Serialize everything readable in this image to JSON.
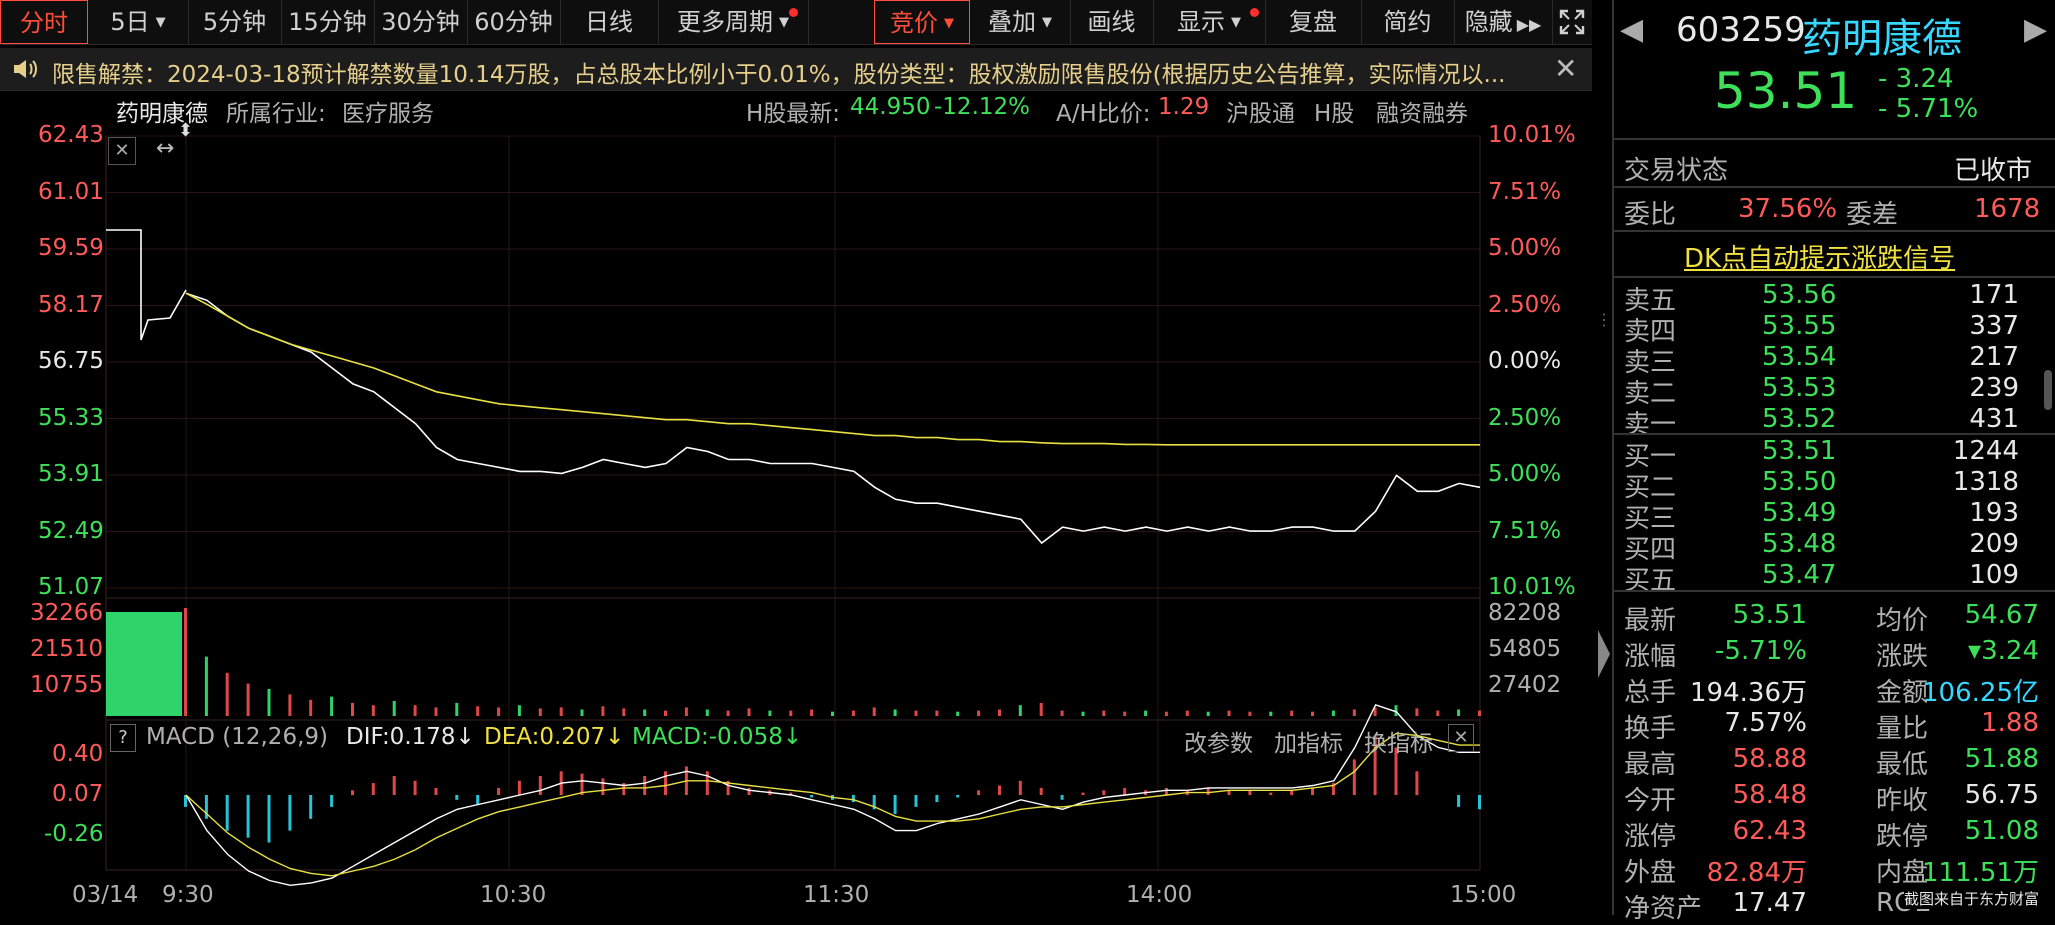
{
  "toolbar": {
    "tabs": [
      {
        "label": "分时",
        "active": true
      },
      {
        "label": "5日"
      },
      {
        "label": "5分钟"
      },
      {
        "label": "15分钟"
      },
      {
        "label": "30分钟"
      },
      {
        "label": "60分钟"
      },
      {
        "label": "日线"
      },
      {
        "label": "更多周期"
      }
    ],
    "right_buttons": [
      "竞价",
      "叠加",
      "画线",
      "显示",
      "复盘",
      "简约",
      "隐藏"
    ]
  },
  "notice": {
    "text": "限售解禁：2024-03-18预计解禁数量10.14万股，占总股本比例小于0.01%，股份类型：股权激励限售股份(根据历史公告推算，实际情况以..."
  },
  "chart_header": {
    "name": "药明康德",
    "industry_label": "所属行业:",
    "industry": "医疗服务",
    "h_label": "H股最新:",
    "h_price": "44.950",
    "h_change": "-12.12%",
    "ah_label": "A/H比价:",
    "ah_value": "1.29",
    "tags": [
      "沪股通",
      "H股",
      "融资融券"
    ]
  },
  "chart_data": {
    "type": "line",
    "x_ticks": [
      "03/14",
      "9:30",
      "10:30",
      "11:30",
      "14:00",
      "15:00"
    ],
    "price_axis": [
      "62.43",
      "61.01",
      "59.59",
      "58.17",
      "56.75",
      "55.33",
      "53.91",
      "52.49",
      "51.07"
    ],
    "pct_axis": [
      "10.01%",
      "7.51%",
      "5.00%",
      "2.50%",
      "0.00%",
      "2.50%",
      "5.00%",
      "7.51%",
      "10.01%"
    ],
    "ylim": [
      51.07,
      62.43
    ],
    "prev_close": 56.75,
    "series": [
      {
        "name": "price",
        "color": "#ffffff",
        "values": [
          58.48,
          58.3,
          57.9,
          57.6,
          57.4,
          57.2,
          57.0,
          56.6,
          56.2,
          56.0,
          55.6,
          55.2,
          54.6,
          54.3,
          54.2,
          54.1,
          54.0,
          54.0,
          53.95,
          54.1,
          54.3,
          54.2,
          54.1,
          54.2,
          54.6,
          54.5,
          54.3,
          54.3,
          54.2,
          54.2,
          54.2,
          54.1,
          54.0,
          53.6,
          53.3,
          53.2,
          53.2,
          53.1,
          53.0,
          52.9,
          52.8,
          52.2,
          52.6,
          52.5,
          52.6,
          52.5,
          52.6,
          52.5,
          52.6,
          52.5,
          52.6,
          52.5,
          52.5,
          52.6,
          52.6,
          52.5,
          52.5,
          53.0,
          53.9,
          53.5,
          53.5,
          53.7,
          53.6
        ]
      },
      {
        "name": "avg",
        "color": "#e8e040",
        "values": [
          58.48,
          58.2,
          57.9,
          57.6,
          57.4,
          57.2,
          57.05,
          56.9,
          56.75,
          56.6,
          56.4,
          56.2,
          56.0,
          55.9,
          55.8,
          55.7,
          55.65,
          55.6,
          55.55,
          55.5,
          55.45,
          55.4,
          55.35,
          55.3,
          55.3,
          55.25,
          55.2,
          55.2,
          55.15,
          55.1,
          55.05,
          55.0,
          54.95,
          54.9,
          54.9,
          54.85,
          54.85,
          54.8,
          54.8,
          54.75,
          54.75,
          54.72,
          54.7,
          54.7,
          54.7,
          54.68,
          54.68,
          54.67,
          54.67,
          54.67,
          54.67,
          54.67,
          54.67,
          54.67,
          54.67,
          54.67,
          54.67,
          54.67,
          54.67,
          54.67,
          54.67,
          54.67,
          54.67
        ]
      }
    ]
  },
  "volume": {
    "left_axis": [
      "32266",
      "21510",
      "10755"
    ],
    "right_axis": [
      "82208",
      "54805",
      "27402"
    ],
    "values": [
      1.0,
      0.55,
      0.4,
      0.3,
      0.25,
      0.2,
      0.15,
      0.18,
      0.12,
      0.1,
      0.14,
      0.1,
      0.08,
      0.12,
      0.09,
      0.08,
      0.1,
      0.07,
      0.08,
      0.06,
      0.09,
      0.07,
      0.06,
      0.05,
      0.08,
      0.06,
      0.05,
      0.07,
      0.05,
      0.05,
      0.06,
      0.04,
      0.05,
      0.08,
      0.06,
      0.05,
      0.05,
      0.04,
      0.05,
      0.06,
      0.1,
      0.12,
      0.05,
      0.04,
      0.05,
      0.04,
      0.05,
      0.04,
      0.05,
      0.04,
      0.05,
      0.04,
      0.04,
      0.05,
      0.04,
      0.05,
      0.06,
      0.08,
      0.1,
      0.07,
      0.05,
      0.06,
      0.05
    ]
  },
  "macd": {
    "help": "?",
    "label": "MACD (12,26,9)",
    "dif": "DIF:0.178↓",
    "dea": "DEA:0.207↓",
    "macd": "MACD:-0.058↓",
    "buttons": [
      "改参数",
      "加指标",
      "换指标"
    ],
    "axis": [
      "0.40",
      "0.07",
      "-0.26"
    ],
    "hist": [
      -0.05,
      -0.1,
      -0.15,
      -0.18,
      -0.2,
      -0.15,
      -0.1,
      -0.05,
      0.02,
      0.05,
      0.08,
      0.06,
      0.03,
      -0.02,
      -0.04,
      0.03,
      0.06,
      0.08,
      0.1,
      0.09,
      0.07,
      0.05,
      0.08,
      0.1,
      0.12,
      0.1,
      0.06,
      0.03,
      0.02,
      0.01,
      -0.01,
      -0.02,
      -0.03,
      -0.06,
      -0.08,
      -0.05,
      -0.03,
      -0.01,
      0.02,
      0.04,
      0.06,
      0.03,
      -0.02,
      0.01,
      0.02,
      0.03,
      0.02,
      0.03,
      0.02,
      0.03,
      0.02,
      0.02,
      0.01,
      0.02,
      0.03,
      0.05,
      0.15,
      0.25,
      0.2,
      0.1,
      0.0,
      -0.05,
      -0.06
    ],
    "dif_values": [
      0.0,
      -0.15,
      -0.25,
      -0.32,
      -0.36,
      -0.38,
      -0.37,
      -0.35,
      -0.3,
      -0.25,
      -0.2,
      -0.15,
      -0.1,
      -0.06,
      -0.04,
      -0.02,
      0.0,
      0.02,
      0.05,
      0.06,
      0.05,
      0.04,
      0.05,
      0.08,
      0.1,
      0.08,
      0.04,
      0.02,
      0.01,
      0.0,
      -0.02,
      -0.04,
      -0.06,
      -0.1,
      -0.15,
      -0.15,
      -0.12,
      -0.1,
      -0.08,
      -0.05,
      -0.02,
      -0.04,
      -0.06,
      -0.03,
      -0.01,
      0.0,
      0.01,
      0.02,
      0.02,
      0.03,
      0.03,
      0.03,
      0.03,
      0.03,
      0.04,
      0.06,
      0.2,
      0.38,
      0.35,
      0.25,
      0.2,
      0.18,
      0.18
    ],
    "dea_values": [
      0.0,
      -0.08,
      -0.16,
      -0.22,
      -0.27,
      -0.31,
      -0.33,
      -0.34,
      -0.32,
      -0.3,
      -0.27,
      -0.23,
      -0.18,
      -0.14,
      -0.1,
      -0.07,
      -0.05,
      -0.03,
      -0.01,
      0.01,
      0.02,
      0.03,
      0.03,
      0.04,
      0.06,
      0.06,
      0.05,
      0.04,
      0.03,
      0.02,
      0.01,
      -0.01,
      -0.02,
      -0.05,
      -0.09,
      -0.11,
      -0.11,
      -0.11,
      -0.1,
      -0.08,
      -0.06,
      -0.05,
      -0.05,
      -0.04,
      -0.03,
      -0.02,
      -0.01,
      0.0,
      0.01,
      0.01,
      0.02,
      0.02,
      0.02,
      0.02,
      0.03,
      0.04,
      0.1,
      0.2,
      0.26,
      0.25,
      0.23,
      0.21,
      0.21
    ]
  },
  "quote": {
    "code": "603259",
    "name": "药明康德",
    "price": "53.51",
    "change": "- 3.24",
    "change_pct": "- 5.71%",
    "status_label": "交易状态",
    "status": "已收市",
    "wb_label": "委比",
    "wb": "37.56%",
    "wc_label": "委差",
    "wc": "1678",
    "dk_link": "DK点自动提示涨跌信号",
    "asks": [
      {
        "label": "卖五",
        "price": "53.56",
        "vol": "171"
      },
      {
        "label": "卖四",
        "price": "53.55",
        "vol": "337"
      },
      {
        "label": "卖三",
        "price": "53.54",
        "vol": "217"
      },
      {
        "label": "卖二",
        "price": "53.53",
        "vol": "239"
      },
      {
        "label": "卖一",
        "price": "53.52",
        "vol": "431"
      }
    ],
    "bids": [
      {
        "label": "买一",
        "price": "53.51",
        "vol": "1244"
      },
      {
        "label": "买二",
        "price": "53.50",
        "vol": "1318"
      },
      {
        "label": "买三",
        "price": "53.49",
        "vol": "193"
      },
      {
        "label": "买四",
        "price": "53.48",
        "vol": "209"
      },
      {
        "label": "买五",
        "price": "53.47",
        "vol": "109"
      }
    ],
    "stats": [
      {
        "l1": "最新",
        "v1": "53.51",
        "c1": "green",
        "l2": "均价",
        "v2": "54.67",
        "c2": "green"
      },
      {
        "l1": "涨幅",
        "v1": "-5.71%",
        "c1": "green",
        "l2": "涨跌",
        "v2": "▾3.24",
        "c2": "green"
      },
      {
        "l1": "总手",
        "v1": "194.36万",
        "c1": "white",
        "l2": "金额",
        "v2": "106.25亿",
        "c2": "cyan"
      },
      {
        "l1": "换手",
        "v1": "7.57%",
        "c1": "white",
        "l2": "量比",
        "v2": "1.88",
        "c2": "red"
      },
      {
        "l1": "最高",
        "v1": "58.88",
        "c1": "red",
        "l2": "最低",
        "v2": "51.88",
        "c2": "green"
      },
      {
        "l1": "今开",
        "v1": "58.48",
        "c1": "red",
        "l2": "昨收",
        "v2": "56.75",
        "c2": "white"
      },
      {
        "l1": "涨停",
        "v1": "62.43",
        "c1": "red",
        "l2": "跌停",
        "v2": "51.08",
        "c2": "green"
      },
      {
        "l1": "外盘",
        "v1": "82.84万",
        "c1": "red",
        "l2": "内盘",
        "v2": "111.51万",
        "c2": "green"
      },
      {
        "l1": "净资产",
        "v1": "17.47",
        "c1": "white",
        "l2": "ROE",
        "v2": "",
        "c2": "white"
      }
    ],
    "watermark": "截图来自于东方财富"
  }
}
